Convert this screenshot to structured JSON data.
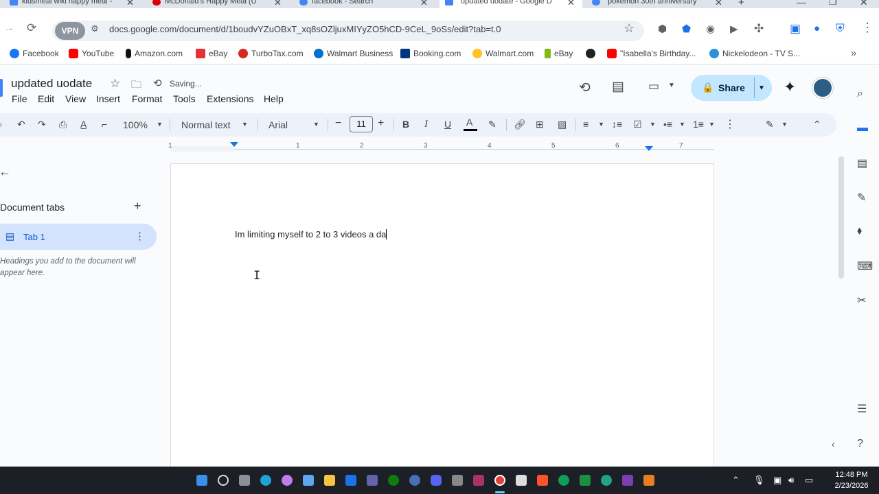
{
  "browser": {
    "tabs": [
      {
        "label": "kidsmeal wiki happy meal - ",
        "color": "#4285f4"
      },
      {
        "label": "McDonald's Happy Meal (U",
        "color": "#db0007"
      },
      {
        "label": "facebook - Search",
        "color": "#4285f4"
      },
      {
        "label": "updated uodate - Google D",
        "color": "#4285f4",
        "active": true
      },
      {
        "label": "pokemon 30th anniversary",
        "color": "#4285f4"
      }
    ],
    "close_glyph": "✕",
    "new_tab_glyph": "+",
    "vpn_label": "VPN",
    "url": "docs.google.com/document/d/1boudvYZuOBxT_xq8sOZljuxMIYyZO5hCD-9CeL_9oSs/edit?tab=t.0",
    "bookmarks": [
      {
        "label": "Facebook",
        "color": "#1877f2"
      },
      {
        "label": "YouTube",
        "color": "#ff0000"
      },
      {
        "label": "Amazon.com",
        "color": "#111111"
      },
      {
        "label": "eBay",
        "color": "#e53238"
      },
      {
        "label": "TurboTax.com",
        "color": "#d52b1e"
      },
      {
        "label": "Walmart Business",
        "color": "#0071ce"
      },
      {
        "label": "Booking.com",
        "color": "#003580"
      },
      {
        "label": "Walmart.com",
        "color": "#ffc220"
      },
      {
        "label": "eBay",
        "color": "#86b817"
      },
      {
        "label": "",
        "color": "#202124"
      },
      {
        "label": "\"Isabella's Birthday...",
        "color": "#ff0000"
      },
      {
        "label": "Nickelodeon - TV S...",
        "color": "#2b8fd9"
      }
    ]
  },
  "docs": {
    "title": "updated uodate",
    "status": "Saving...",
    "menus": [
      "File",
      "Edit",
      "View",
      "Insert",
      "Format",
      "Tools",
      "Extensions",
      "Help"
    ],
    "share_label": "Share",
    "toolbar": {
      "zoom": "100%",
      "style": "Normal text",
      "font": "Arial",
      "font_size": "11",
      "bold": "B",
      "italic": "I",
      "underline": "U",
      "text_color": "A"
    },
    "ruler_numbers": [
      "1",
      "1",
      "2",
      "3",
      "4",
      "5",
      "6",
      "7"
    ],
    "sidebar": {
      "heading": "Document tabs",
      "tab_name": "Tab 1",
      "hint": "Headings you add to the document will appear here."
    },
    "body_text": "Im limiting myself to 2 to 3 videos a da"
  },
  "taskbar": {
    "time": "12:48 PM",
    "date": "2/23/2026"
  },
  "colors": {
    "share_bg": "#c2e7ff",
    "tab_active_bg": "#d3e3fd",
    "toolbar_bg": "#edf2fa"
  }
}
